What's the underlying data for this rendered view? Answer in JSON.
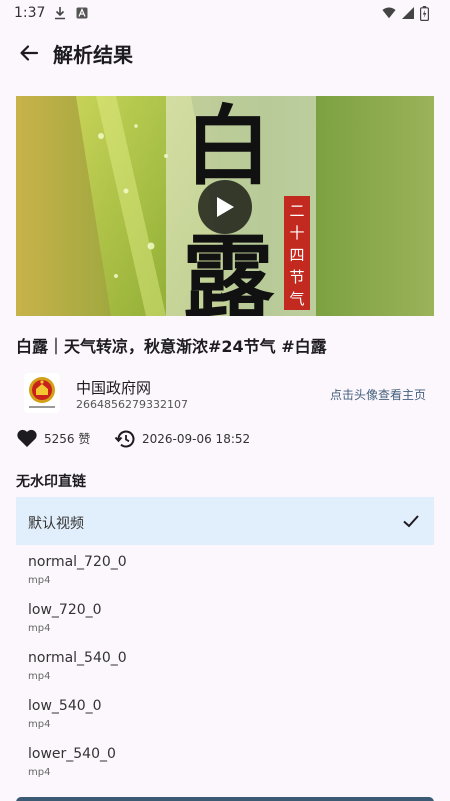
{
  "status_bar": {
    "time": "1:37"
  },
  "app_bar": {
    "title": "解析结果"
  },
  "video": {
    "poster_title": "白露",
    "poster_side_text": "二十四节气"
  },
  "video_title": "白露｜天气转凉，秋意渐浓#24节气 #白露",
  "author": {
    "name": "中国政府网",
    "id": "2664856279332107",
    "hint": "点击头像查看主页"
  },
  "stats": {
    "likes": "5256 赞",
    "publish_time": "2026-09-06 18:52"
  },
  "section_label": "无水印直链",
  "links": [
    {
      "name": "默认视频",
      "format": "",
      "selected": true
    },
    {
      "name": "normal_720_0",
      "format": "mp4"
    },
    {
      "name": "low_720_0",
      "format": "mp4"
    },
    {
      "name": "normal_540_0",
      "format": "mp4"
    },
    {
      "name": "low_540_0",
      "format": "mp4"
    },
    {
      "name": "lower_540_0",
      "format": "mp4"
    }
  ],
  "colors": {
    "background": "#fcf7fd",
    "selected_row": "#e1eefb",
    "accent": "#3b5a74"
  }
}
